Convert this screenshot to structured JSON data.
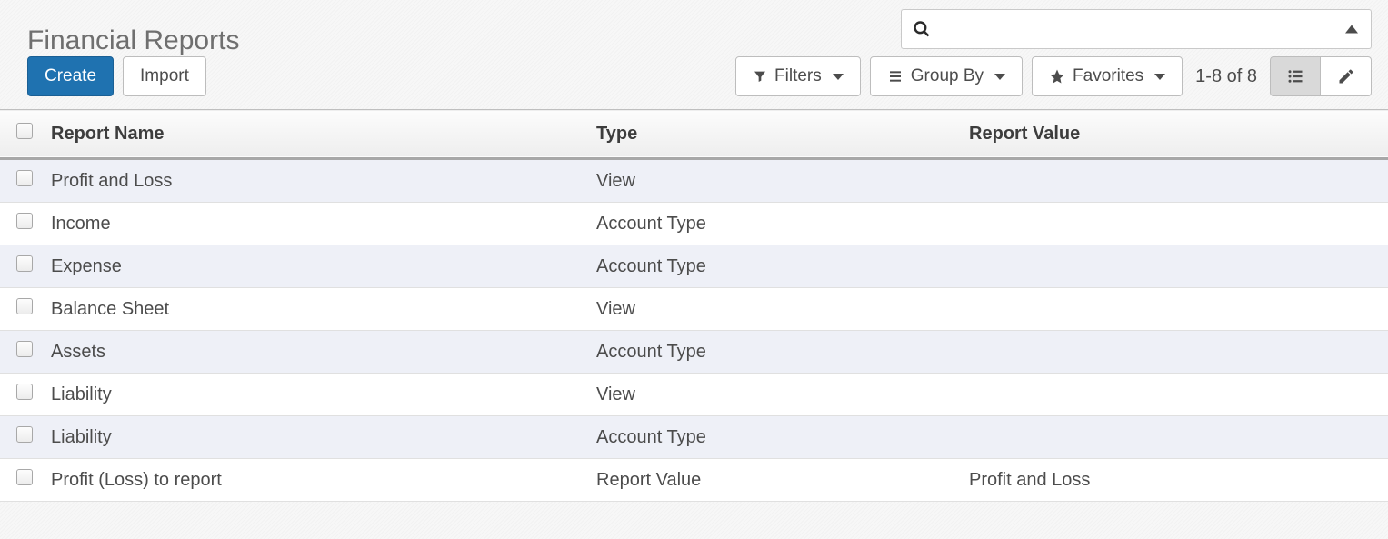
{
  "header": {
    "title": "Financial Reports"
  },
  "search": {
    "placeholder": ""
  },
  "actions": {
    "create": "Create",
    "import": "Import"
  },
  "toolbar": {
    "filters": "Filters",
    "group_by": "Group By",
    "favorites": "Favorites",
    "pager": "1-8 of 8"
  },
  "table": {
    "headers": {
      "name": "Report Name",
      "type": "Type",
      "value": "Report Value"
    },
    "rows": [
      {
        "name": "Profit and Loss",
        "type": "View",
        "value": ""
      },
      {
        "name": "Income",
        "type": "Account Type",
        "value": ""
      },
      {
        "name": "Expense",
        "type": "Account Type",
        "value": ""
      },
      {
        "name": "Balance Sheet",
        "type": "View",
        "value": ""
      },
      {
        "name": "Assets",
        "type": "Account Type",
        "value": ""
      },
      {
        "name": "Liability",
        "type": "View",
        "value": ""
      },
      {
        "name": "Liability",
        "type": "Account Type",
        "value": ""
      },
      {
        "name": "Profit (Loss) to report",
        "type": "Report Value",
        "value": "Profit and Loss"
      }
    ]
  }
}
